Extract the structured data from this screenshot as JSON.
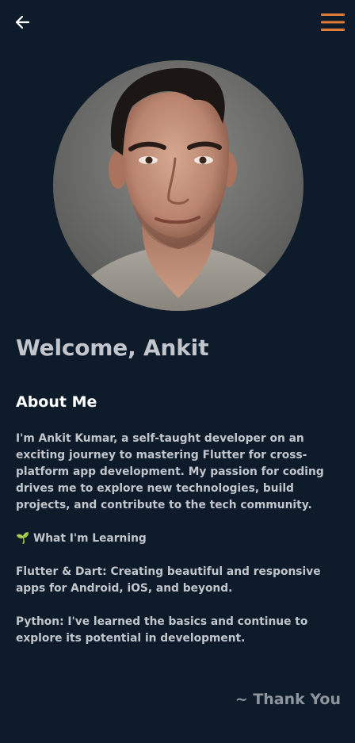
{
  "app_bar": {
    "back_icon": "arrow-back-icon",
    "menu_icon": "menu-icon",
    "menu_color": "#e07b39"
  },
  "profile": {
    "avatar": "profile-photo-of-man",
    "welcome": "Welcome, Ankit"
  },
  "about": {
    "heading": "About Me",
    "intro": "I'm Ankit Kumar, a self-taught developer on an exciting journey to mastering Flutter for cross-platform app development. My passion for coding drives me to explore new technologies, build projects, and contribute to the tech community.",
    "learning_emoji": "🌱",
    "learning_heading": "What I'm Learning",
    "flutter_text": "Flutter & Dart: Creating beautiful and responsive apps for Android, iOS, and beyond.",
    "python_text": "Python: I've learned the basics and continue to explore its potential in development."
  },
  "footer": {
    "thank_you": "~ Thank You"
  },
  "colors": {
    "background": "#0d1b2a",
    "text": "#c2c6cc",
    "heading": "#ffffff",
    "accent": "#e07b39"
  }
}
